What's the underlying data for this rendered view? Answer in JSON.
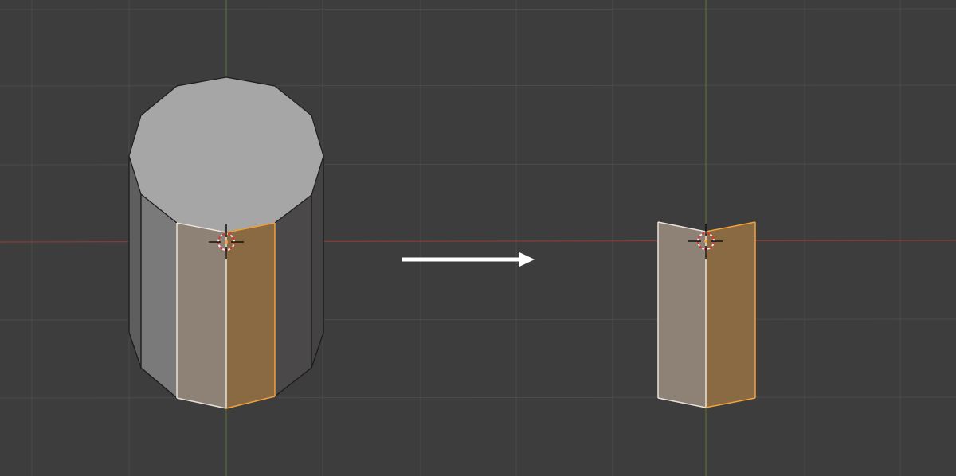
{
  "viewport": {
    "background_color": "#3d3d3d",
    "grid_color": "#4b4b4b",
    "x_axis_color": "#9c3a3a",
    "y_axis_color": "#5a7a2a"
  },
  "mesh": {
    "body_light": "#7a7a7a",
    "body_dark": "#5e5e5e",
    "cap_color": "#a6a6a6",
    "back_dark": "#4a4848",
    "edge_color": "#1e1e1e",
    "selected_face_color": "#8e8176",
    "active_face_color": "#8a6a43",
    "selected_edge_color": "#e9e2da",
    "active_edge_color": "#f2a23a"
  },
  "cursor": {
    "icon": "3d-cursor-icon",
    "ring_primary": "#e03030",
    "ring_secondary": "#f0f0f0"
  },
  "arrow": {
    "icon": "right-arrow-icon",
    "color": "#ffffff"
  }
}
